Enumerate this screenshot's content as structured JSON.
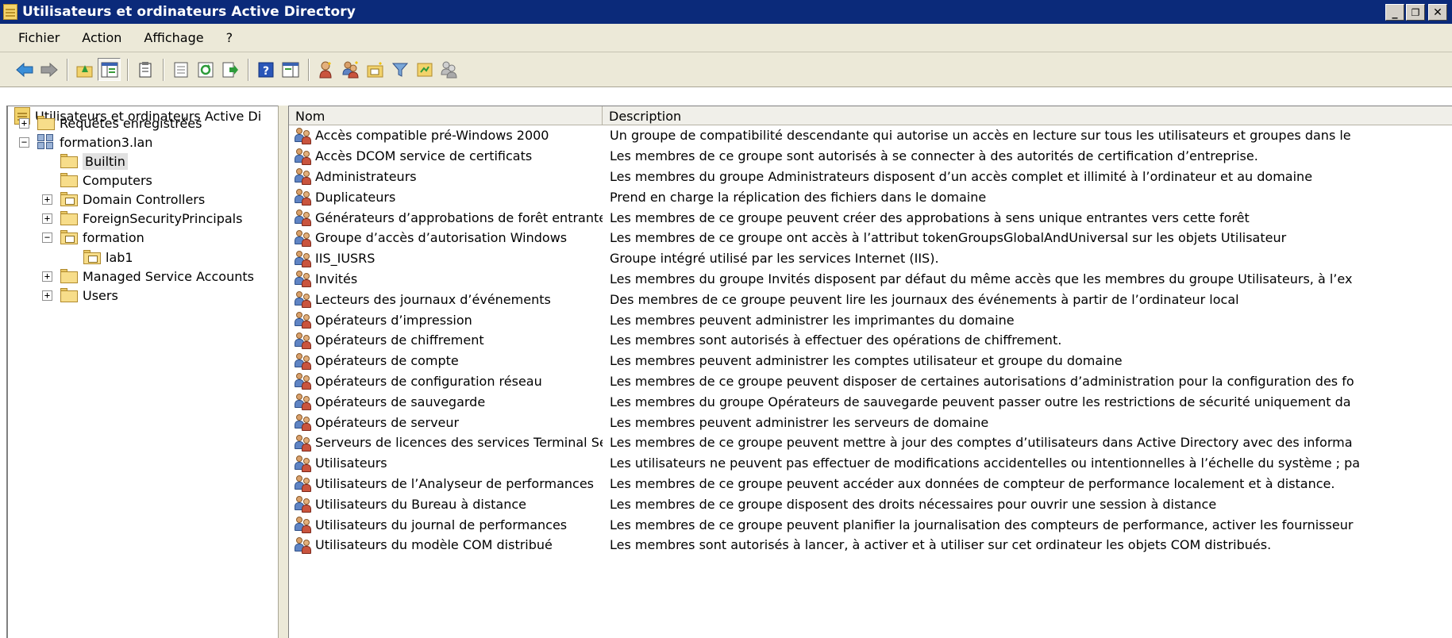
{
  "window": {
    "title": "Utilisateurs et ordinateurs Active Directory",
    "controls": {
      "minimize": "_",
      "restore": "❐",
      "close": "✕"
    }
  },
  "menu": {
    "items": [
      "Fichier",
      "Action",
      "Affichage",
      "?"
    ]
  },
  "toolbar": {
    "buttons": [
      "back-arrow-icon",
      "forward-arrow-icon",
      "up-folder-icon",
      "show-console-tree-icon",
      "clipboard-icon",
      "properties-icon",
      "refresh-icon",
      "export-list-icon",
      "help-icon",
      "action-pane-icon",
      "new-user-icon",
      "new-group-icon",
      "new-ou-icon",
      "filter-icon",
      "find-icon",
      "add-to-group-icon"
    ]
  },
  "tree": {
    "root": "Utilisateurs et ordinateurs Active Di",
    "saved_queries": "Requêtes enregistrées",
    "domain": "formation3.lan",
    "builtin": "Builtin",
    "computers": "Computers",
    "domain_controllers": "Domain Controllers",
    "fsp": "ForeignSecurityPrincipals",
    "formation": "formation",
    "lab1": "lab1",
    "msa": "Managed Service Accounts",
    "users": "Users",
    "expanders": {
      "collapsed": "+",
      "expanded": "−"
    }
  },
  "list": {
    "columns": {
      "name": "Nom",
      "description": "Description"
    },
    "rows": [
      {
        "name": "Accès compatible pré-Windows 2000",
        "description": "Un groupe de compatibilité descendante qui autorise un accès en lecture sur tous les utilisateurs et groupes dans le"
      },
      {
        "name": "Accès DCOM service de certificats",
        "description": "Les membres de ce groupe sont autorisés à se connecter à des autorités de certification d’entreprise."
      },
      {
        "name": "Administrateurs",
        "description": "Les membres du groupe Administrateurs disposent d’un accès complet et illimité à l’ordinateur et au domaine"
      },
      {
        "name": "Duplicateurs",
        "description": "Prend en charge la réplication des fichiers dans le domaine"
      },
      {
        "name": "Générateurs d’approbations de forêt entrante",
        "description": "Les membres de ce groupe peuvent créer des approbations à sens unique entrantes vers cette forêt"
      },
      {
        "name": "Groupe d’accès d’autorisation Windows",
        "description": "Les membres de ce groupe ont accès à l’attribut tokenGroupsGlobalAndUniversal sur les objets Utilisateur"
      },
      {
        "name": "IIS_IUSRS",
        "description": "Groupe intégré utilisé par les services Internet (IIS)."
      },
      {
        "name": "Invités",
        "description": "Les membres du groupe Invités disposent par défaut du même accès que les membres du groupe Utilisateurs, à l’ex"
      },
      {
        "name": "Lecteurs des journaux d’événements",
        "description": "Des membres de ce groupe peuvent lire les journaux des événements à partir de l’ordinateur local"
      },
      {
        "name": "Opérateurs d’impression",
        "description": "Les membres peuvent administrer les imprimantes du domaine"
      },
      {
        "name": "Opérateurs de chiffrement",
        "description": "Les membres sont autorisés à effectuer des opérations de chiffrement."
      },
      {
        "name": "Opérateurs de compte",
        "description": "Les membres peuvent administrer les comptes utilisateur et groupe du domaine"
      },
      {
        "name": "Opérateurs de configuration réseau",
        "description": "Les membres de ce groupe peuvent disposer de certaines autorisations d’administration pour la configuration des fo"
      },
      {
        "name": "Opérateurs de sauvegarde",
        "description": "Les membres du groupe Opérateurs de sauvegarde peuvent passer outre les restrictions de sécurité uniquement da"
      },
      {
        "name": "Opérateurs de serveur",
        "description": "Les membres peuvent administrer les serveurs de domaine"
      },
      {
        "name": "Serveurs de licences des services Terminal Server",
        "description": "Les membres de ce groupe peuvent mettre à jour des comptes d’utilisateurs dans Active Directory avec des informa"
      },
      {
        "name": "Utilisateurs",
        "description": "Les utilisateurs ne peuvent pas effectuer de modifications accidentelles ou intentionnelles à l’échelle du système ; pa"
      },
      {
        "name": "Utilisateurs de l’Analyseur de performances",
        "description": "Les membres de ce groupe peuvent accéder aux données de compteur de performance localement et à distance."
      },
      {
        "name": "Utilisateurs du Bureau à distance",
        "description": "Les membres de ce groupe disposent des droits nécessaires pour ouvrir une session à distance"
      },
      {
        "name": "Utilisateurs du journal de performances",
        "description": "Les membres de ce groupe peuvent planifier la journalisation des compteurs de performance, activer les fournisseur"
      },
      {
        "name": "Utilisateurs du modèle COM distribué",
        "description": "Les membres sont autorisés à lancer, à activer et à utiliser sur cet ordinateur les objets COM distribués."
      }
    ]
  },
  "colors": {
    "titlebar": "#0b2a7a",
    "chrome": "#ece9d8",
    "selection": "#e1e1e1"
  }
}
